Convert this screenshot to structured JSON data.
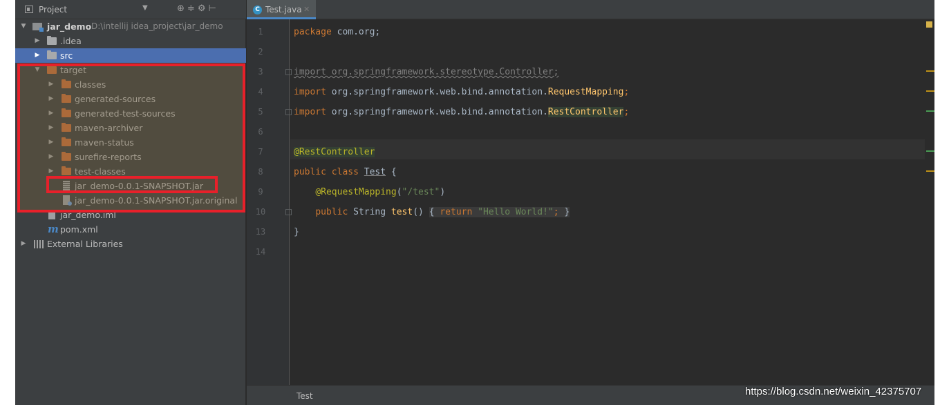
{
  "project_panel": {
    "title": "Project",
    "root": {
      "name": "jar_demo",
      "path": "D:\\intellij idea_project\\jar_demo"
    },
    "items": [
      {
        "label": ".idea"
      },
      {
        "label": "src"
      },
      {
        "label": "target"
      },
      {
        "label": "classes"
      },
      {
        "label": "generated-sources"
      },
      {
        "label": "generated-test-sources"
      },
      {
        "label": "maven-archiver"
      },
      {
        "label": "maven-status"
      },
      {
        "label": "surefire-reports"
      },
      {
        "label": "test-classes"
      },
      {
        "label": "jar_demo-0.0.1-SNAPSHOT.jar"
      },
      {
        "label": "jar_demo-0.0.1-SNAPSHOT.jar.original"
      },
      {
        "label": "jar_demo.iml"
      },
      {
        "label": "pom.xml"
      },
      {
        "label": "External Libraries"
      }
    ]
  },
  "editor": {
    "tab": {
      "label": "Test.java"
    },
    "line_numbers": [
      "1",
      "2",
      "3",
      "4",
      "5",
      "6",
      "7",
      "8",
      "9",
      "10",
      "13",
      "14"
    ],
    "code": {
      "l1": {
        "kw": "package",
        "rest": " com.org;"
      },
      "l3": {
        "text": "import org.springframework.stereotype.Controller;"
      },
      "l4": {
        "kw": "import",
        "pkg": " org.springframework.web.bind.annotation.",
        "cls": "RequestMapping",
        "end": ";"
      },
      "l5": {
        "kw": "import",
        "pkg": " org.springframework.web.bind.annotation.",
        "cls": "RestController",
        "end": ";"
      },
      "l7": {
        "ann": "@RestController"
      },
      "l8": {
        "kw": "public class",
        "cls": "Test",
        "end": " {"
      },
      "l9": {
        "ann": "@RequestMapping",
        "open": "(",
        "str": "\"/test\"",
        "close": ")"
      },
      "l10": {
        "kw1": "public",
        "type": " String ",
        "fn": "test",
        "paren": "()",
        "brace_open": "{",
        "kw2": "return",
        "str": "\"Hello World!\"",
        "semi": ";",
        "brace_close": "}"
      },
      "l13": {
        "text": "}"
      }
    },
    "breadcrumb": "Test"
  },
  "watermark": "https://blog.csdn.net/weixin_42375707",
  "colors": {
    "selection": "#4b6eaf",
    "highlight_border": "#e8202a",
    "keyword": "#cc7832",
    "annotation": "#bbb529",
    "string": "#6a8759"
  }
}
